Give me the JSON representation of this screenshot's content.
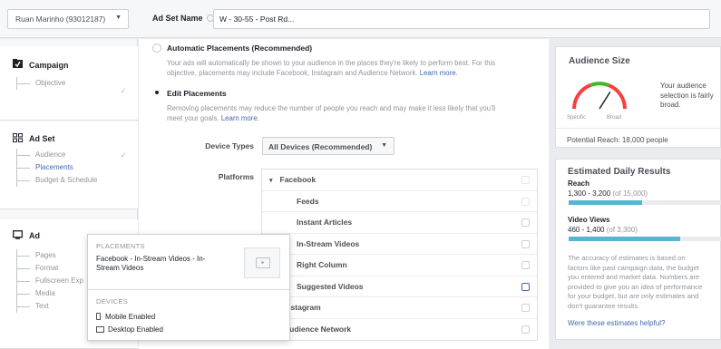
{
  "header": {
    "account_selector": "Ruan Marinho (93012187)",
    "adset_name_label": "Ad Set Name",
    "adset_name_value": "W - 30-55 - Post Rd..."
  },
  "sidebar": {
    "campaign": {
      "title": "Campaign",
      "items": [
        "Objective"
      ]
    },
    "adset": {
      "title": "Ad Set",
      "items": [
        "Audience",
        "Placements",
        "Budget & Schedule"
      ]
    },
    "ad": {
      "title": "Ad",
      "items": [
        "Pages",
        "Format",
        "Fullscreen Exp",
        "Media",
        "Text"
      ]
    }
  },
  "placements": {
    "auto_title": "Automatic Placements (Recommended)",
    "auto_desc_1": "Your ads will automatically be shown to your audience in the places they're likely to perform best. For this",
    "auto_desc_2": "objective, placements may include Facebook, Instagram and Audience Network.",
    "auto_link": "Learn more.",
    "edit_title": "Edit Placements",
    "edit_desc_1": "Removing placements may reduce the number of people you reach and may make it less likely that you'll",
    "edit_desc_2": "meet your goals.",
    "edit_link": "Learn more.",
    "device_types_label": "Device Types",
    "device_types_value": "All Devices (Recommended)",
    "platforms_label": "Platforms",
    "platform_rows": [
      "Facebook",
      "Feeds",
      "Instant Articles",
      "In-Stream Videos",
      "Right Column",
      "Suggested Videos",
      "Instagram",
      "Audience Network"
    ]
  },
  "popup": {
    "placements_heading": "PLACEMENTS",
    "placements_text_1": "Facebook  -  In-Stream Videos  -  In-",
    "placements_text_2": "Stream Videos",
    "devices_heading": "DEVICES",
    "device_1": "Mobile Enabled",
    "device_2": "Desktop Enabled"
  },
  "audience_size": {
    "title": "Audience Size",
    "desc_1": "Your audience",
    "desc_2": "selection is fairly",
    "desc_3": "broad.",
    "specific": "Specific",
    "broad": "Broad",
    "potential_reach": "Potential Reach: 18,000 people",
    "gauge_position": 0.68
  },
  "estimated": {
    "title": "Estimated Daily Results",
    "reach_label": "Reach",
    "reach_range": "1,300 - 3,200",
    "reach_total": "(of 15,000)",
    "reach_fill": 0.48,
    "views_label": "Video Views",
    "views_range": "460 - 1,400",
    "views_total": "(of 3,300)",
    "views_fill": 0.73,
    "note_1": "The accuracy of estimates is based on",
    "note_2": "factors like past campaign data, the budget",
    "note_3": "you entered and market data. Numbers are",
    "note_4": "provided to give you an idea of performance",
    "note_5": "for your budget, but are only estimates and",
    "note_6": "don't guarantee results.",
    "helpful_link": "Were these estimates helpful?"
  },
  "colors": {
    "accent": "#4267b2",
    "bar": "#58b4d1",
    "gauge_green": "#42b72a",
    "gauge_red": "#fa3e3e"
  }
}
